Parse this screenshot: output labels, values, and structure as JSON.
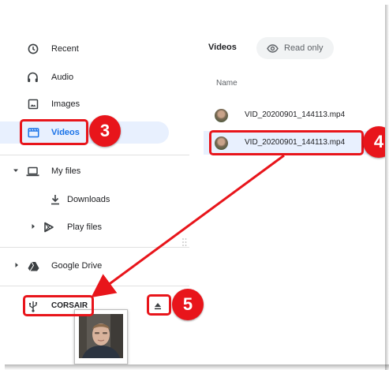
{
  "sidebar": {
    "items": [
      {
        "label": "Recent",
        "icon": "clock-icon"
      },
      {
        "label": "Audio",
        "icon": "headphones-icon"
      },
      {
        "label": "Images",
        "icon": "image-icon"
      },
      {
        "label": "Videos",
        "icon": "video-icon",
        "selected": true
      },
      {
        "label": "My files",
        "icon": "laptop-icon"
      },
      {
        "label": "Downloads",
        "icon": "download-icon"
      },
      {
        "label": "Play files",
        "icon": "play-store-icon"
      },
      {
        "label": "Google Drive",
        "icon": "drive-icon"
      },
      {
        "label": "CORSAIR",
        "icon": "usb-icon"
      }
    ]
  },
  "main": {
    "title": "Videos",
    "chip_label": "Read only",
    "column_name": "Name",
    "files": [
      {
        "name": "VID_20200901_144113.mp4",
        "selected": false
      },
      {
        "name": "VID_20200901_144113.mp4",
        "selected": true
      }
    ]
  },
  "annotations": {
    "step3": "3",
    "step4": "4",
    "step5": "5"
  },
  "colors": {
    "accent": "#1a73e8",
    "selection": "#e8f0fe",
    "annotation": "#e8151b"
  }
}
